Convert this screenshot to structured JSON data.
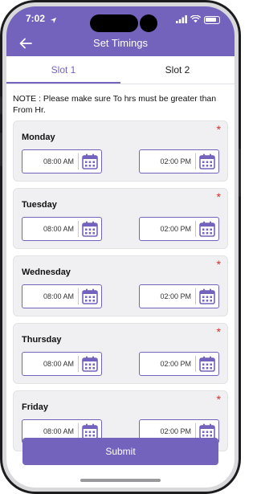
{
  "status": {
    "time": "7:02"
  },
  "header": {
    "title": "Set Timings",
    "back_icon": "arrow-left-icon"
  },
  "tabs": [
    {
      "label": "Slot 1",
      "active": true
    },
    {
      "label": "Slot 2",
      "active": false
    }
  ],
  "note": "NOTE : Please make sure To hrs must be greater than From Hr.",
  "days": [
    {
      "name": "Monday",
      "from": "08:00 AM",
      "to": "02:00 PM"
    },
    {
      "name": "Tuesday",
      "from": "08:00 AM",
      "to": "02:00 PM"
    },
    {
      "name": "Wednesday",
      "from": "08:00 AM",
      "to": "02:00 PM"
    },
    {
      "name": "Thursday",
      "from": "08:00 AM",
      "to": "02:00 PM"
    },
    {
      "name": "Friday",
      "from": "08:00 AM",
      "to": "02:00 PM"
    }
  ],
  "required_mark": "*",
  "submit_label": "Submit",
  "colors": {
    "accent": "#7463bd",
    "required": "#e02a2a"
  }
}
